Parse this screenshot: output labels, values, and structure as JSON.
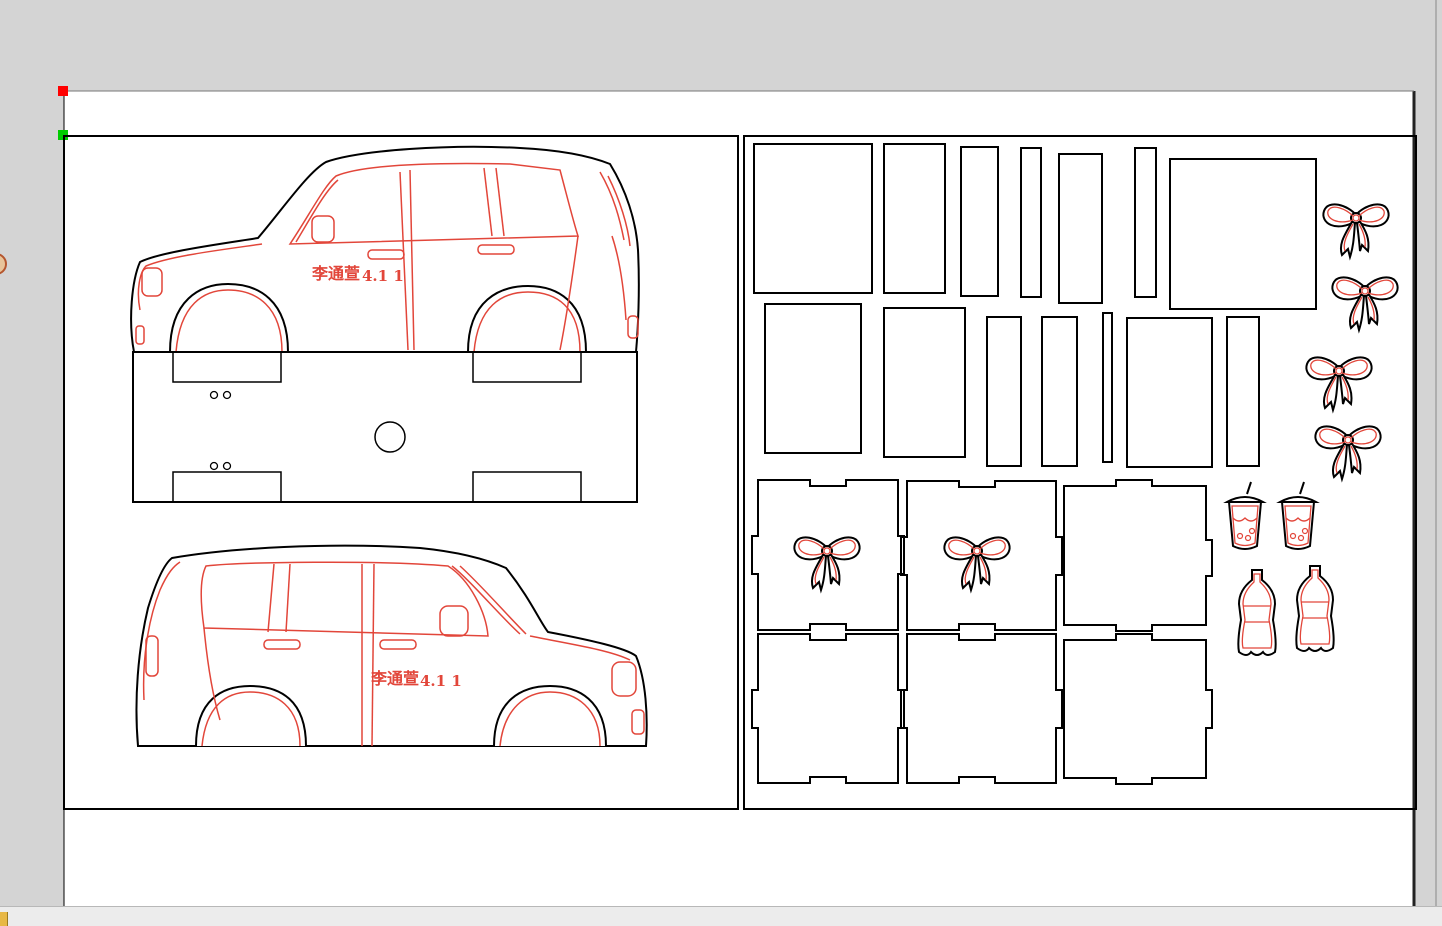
{
  "canvas": {
    "paper_color": "#ffffff",
    "workspace_color": "#d4d4d4",
    "cut_color": "#000000",
    "engrave_color": "#e2463a"
  },
  "handles": {
    "origin_handle_color": "#ff0000",
    "selection_handle_color": "#00cc00"
  },
  "car_top": {
    "label_name": "李通萱",
    "label_number": "4.1 1"
  },
  "car_bottom": {
    "label_name": "李通萱",
    "label_number": "4.1 1"
  },
  "statusbar": {
    "text": ""
  },
  "icons": {
    "bow": "bow-decoration-icon",
    "drink": "bubble-tea-cup-icon",
    "bottle": "soda-bottle-icon",
    "status": "status-indicator-icon"
  }
}
